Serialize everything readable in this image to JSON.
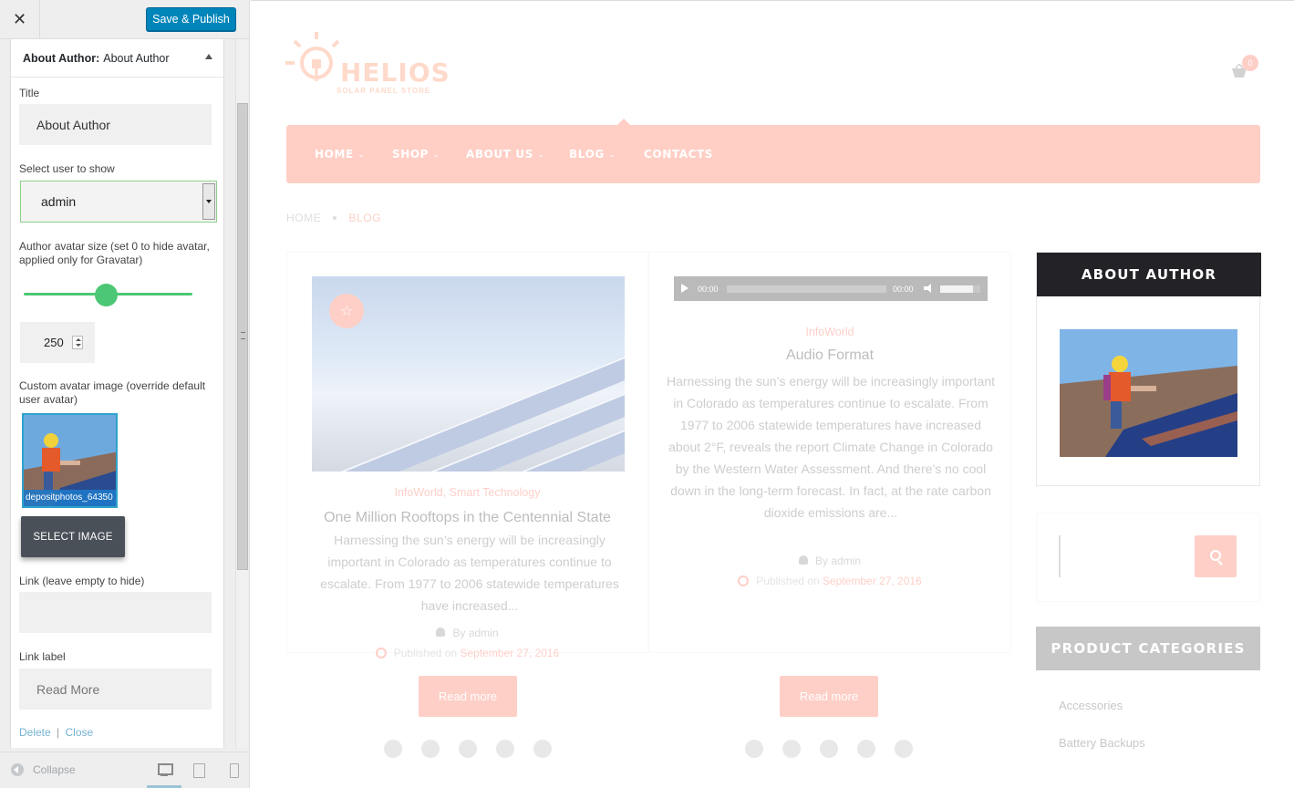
{
  "customizer": {
    "close_icon": "close-icon",
    "save_label": "Save & Publish",
    "widget": {
      "type_label": "About Author:",
      "title_label": "About Author",
      "fields": {
        "title_label": "Title",
        "title_value": "About Author",
        "user_label": "Select user to show",
        "user_value": "admin",
        "avatar_size_label": "Author avatar size (set 0 to hide avatar, applied only for Gravatar)",
        "avatar_size_value": "250",
        "custom_avatar_label": "Custom avatar image (override default user avatar)",
        "avatar_filename": "depositphotos_64350",
        "select_image_label": "SELECT IMAGE",
        "link_label": "Link (leave empty to hide)",
        "link_value": "",
        "link_text_label": "Link label",
        "link_text_value": "Read More"
      },
      "actions": {
        "delete": "Delete",
        "separator": "|",
        "close": "Close"
      }
    },
    "footer": {
      "collapse_label": "Collapse",
      "devices": [
        "desktop-icon",
        "tablet-icon",
        "mobile-icon"
      ]
    }
  },
  "site": {
    "logo": {
      "name": "HELIOS",
      "tagline": "SOLAR PANEL STORE"
    },
    "cart_count": "0",
    "nav": [
      {
        "label": "HOME",
        "dropdown": true
      },
      {
        "label": "SHOP",
        "dropdown": true
      },
      {
        "label": "ABOUT US",
        "dropdown": true
      },
      {
        "label": "BLOG",
        "dropdown": true
      },
      {
        "label": "CONTACTS",
        "dropdown": false
      }
    ],
    "breadcrumb": {
      "home": "HOME",
      "current": "BLOG"
    },
    "posts": [
      {
        "categories": "InfoWorld, Smart Technology",
        "title": "One Million Rooftops in the Centennial State",
        "excerpt": "Harnessing the sun’s energy will be increasingly important in Colorado as temperatures continue to escalate. From 1977 to 2006 statewide temperatures have increased...",
        "author": "By admin",
        "published_prefix": "Published on",
        "date": "September 27, 2016",
        "read_more": "Read more"
      },
      {
        "categories": "InfoWorld",
        "title": "Audio Format",
        "excerpt": "Harnessing the sun’s energy will be increasingly important in Colorado as temperatures continue to escalate. From 1977 to 2006 statewide temperatures have increased about 2°F, reveals the report Climate Change in Colorado by the Western Water Assessment. And there’s no cool down in the long-term forecast. In fact, at the rate carbon dioxide emissions are...",
        "author": "By admin",
        "published_prefix": "Published on",
        "date": "September 27, 2016",
        "read_more": "Read more",
        "audio": {
          "current": "00:00",
          "duration": "00:00"
        }
      }
    ],
    "sidebar": {
      "about_title": "ABOUT AUTHOR",
      "categories_title": "PRODUCT CATEGORIES",
      "categories": [
        "Accessories",
        "Battery Backups"
      ]
    }
  },
  "colors": {
    "accent": "#fe6c54",
    "primary_button": "#0085ba",
    "slider": "#4cc775",
    "widget_dark": "#222227"
  }
}
